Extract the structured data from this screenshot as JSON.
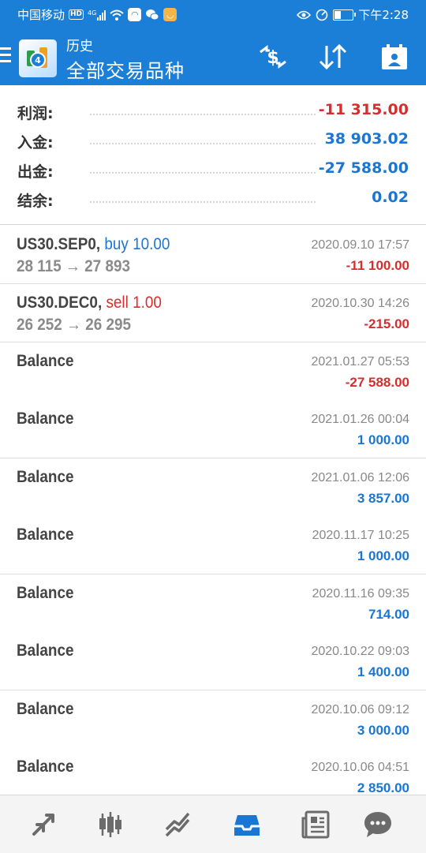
{
  "status_bar": {
    "carrier": "中国移动",
    "hd": "HD",
    "network": "4G",
    "time": "下午2:28"
  },
  "app_bar": {
    "title": "历史",
    "subtitle": "全部交易品种"
  },
  "summary": [
    {
      "label": "利润:",
      "value": "-11 315.00",
      "color": "#d32f2f"
    },
    {
      "label": "入金:",
      "value": "38 903.02",
      "color": "#1976d2"
    },
    {
      "label": "出金:",
      "value": "-27 588.00",
      "color": "#1976d2"
    },
    {
      "label": "结余:",
      "value": "0.02",
      "color": "#1976d2"
    }
  ],
  "trades": [
    {
      "symbol": "US30.SEP0,",
      "type": "buy",
      "volume": "10.00",
      "prices": "28 115 → 27 893",
      "date": "2020.09.10 17:57",
      "amount": "-11 100.00",
      "sign": "neg"
    },
    {
      "symbol": "US30.DEC0,",
      "type": "sell",
      "volume": "1.00",
      "prices": "26 252 → 26 295",
      "date": "2020.10.30 14:26",
      "amount": "-215.00",
      "sign": "neg"
    },
    {
      "title": "Balance",
      "date": "2021.01.27 05:53",
      "amount": "-27 588.00",
      "sign": "neg"
    },
    {
      "title": "Balance",
      "date": "2021.01.26 00:04",
      "amount": "1 000.00",
      "sign": "pos"
    },
    {
      "title": "Balance",
      "date": "2021.01.06 12:06",
      "amount": "3 857.00",
      "sign": "pos"
    },
    {
      "title": "Balance",
      "date": "2020.11.17 10:25",
      "amount": "1 000.00",
      "sign": "pos"
    },
    {
      "title": "Balance",
      "date": "2020.11.16 09:35",
      "amount": "714.00",
      "sign": "pos"
    },
    {
      "title": "Balance",
      "date": "2020.10.22 09:03",
      "amount": "1 400.00",
      "sign": "pos"
    },
    {
      "title": "Balance",
      "date": "2020.10.06 09:12",
      "amount": "3 000.00",
      "sign": "pos"
    },
    {
      "title": "Balance",
      "date": "2020.10.06 04:51",
      "amount": "2 850.00",
      "sign": "pos"
    }
  ],
  "toolbar_icons": [
    "currency-exchange-icon",
    "sort-icon",
    "calendar-icon"
  ],
  "bottom_nav": [
    {
      "icon": "trade-arrows-icon",
      "active": false
    },
    {
      "icon": "candlestick-chart-icon",
      "active": false
    },
    {
      "icon": "trend-line-icon",
      "active": false
    },
    {
      "icon": "history-inbox-icon",
      "active": true
    },
    {
      "icon": "news-icon",
      "active": false
    },
    {
      "icon": "chat-bubble-icon",
      "active": false
    }
  ],
  "colors": {
    "header": "#1b7fd8",
    "negative": "#d32f2f",
    "positive": "#1976d2",
    "nav_active": "#1976d2",
    "nav_inactive": "#6b6b6b"
  }
}
